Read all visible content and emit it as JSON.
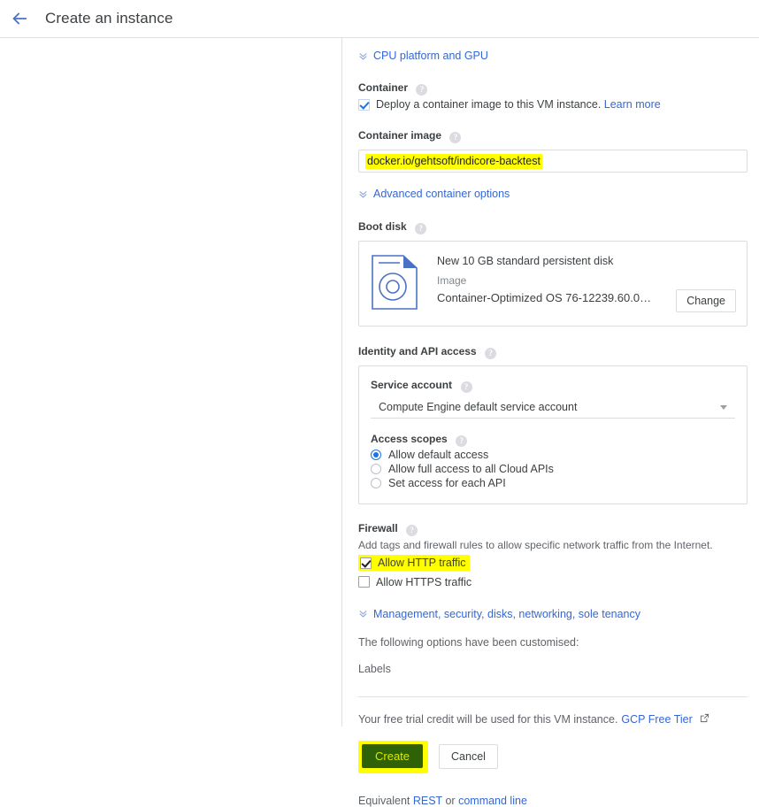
{
  "header": {
    "back_icon": "back-arrow-icon",
    "title": "Create an instance"
  },
  "form": {
    "cpu_platform_link": "CPU platform and GPU",
    "container": {
      "label": "Container",
      "help": "?",
      "checkbox_checked": true,
      "checkbox_label": "Deploy a container image to this VM instance.",
      "learn_more": "Learn more"
    },
    "container_image": {
      "label": "Container image",
      "help": "?",
      "value": "docker.io/gehtsoft/indicore-backtest",
      "placeholder": "Container image",
      "highlighted": true
    },
    "advanced_container_options_link": "Advanced container options",
    "boot_disk": {
      "label": "Boot disk",
      "help": "?",
      "icon": "boot-disk-icon",
      "title": "New 10 GB standard persistent disk",
      "image_caption": "Image",
      "image_value": "Container-Optimized OS 76-12239.60.0…",
      "change_button": "Change"
    },
    "identity": {
      "label": "Identity and API access",
      "help": "?",
      "service_account": {
        "label": "Service account",
        "help": "?",
        "selected": "Compute Engine default service account"
      },
      "access_scopes": {
        "label": "Access scopes",
        "help": "?",
        "options": [
          {
            "label": "Allow default access",
            "selected": true
          },
          {
            "label": "Allow full access to all Cloud APIs",
            "selected": false
          },
          {
            "label": "Set access for each API",
            "selected": false
          }
        ]
      }
    },
    "firewall": {
      "label": "Firewall",
      "help": "?",
      "description": "Add tags and firewall rules to allow specific network traffic from the Internet.",
      "http": {
        "label": "Allow HTTP traffic",
        "checked": true,
        "highlighted": true
      },
      "https": {
        "label": "Allow HTTPS traffic",
        "checked": false,
        "highlighted": false
      }
    },
    "management_link": "Management, security, disks, networking, sole tenancy",
    "customised_intro": "The following options have been customised:",
    "customised_items": [
      "Labels"
    ]
  },
  "footer": {
    "trial_text": "Your free trial credit will be used for this VM instance.",
    "trial_link": "GCP Free Tier",
    "external_icon": "external-link-icon",
    "create_button": "Create",
    "create_highlighted": true,
    "cancel_button": "Cancel",
    "equivalent_prefix": "Equivalent",
    "equivalent_rest": "REST",
    "equivalent_or": "or",
    "equivalent_cli": "command line"
  },
  "colors": {
    "accent_blue": "#3367d6",
    "highlight_yellow": "#ffff00",
    "create_button_blended": "#2f6206",
    "text_primary": "#3c4043",
    "text_muted": "#5f6368"
  }
}
